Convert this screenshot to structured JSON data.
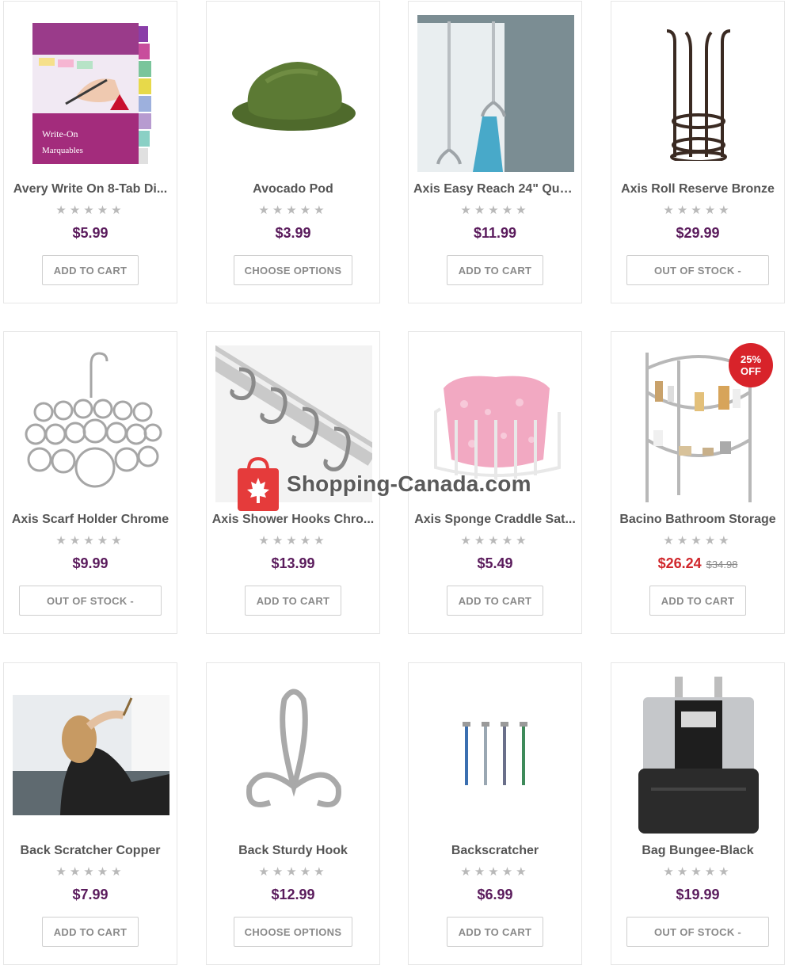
{
  "products": [
    {
      "name": "Avery Write On 8-Tab Di...",
      "stars": "★★★★★",
      "price": "$5.99",
      "button": "ADD TO CART",
      "icon": "binder-dividers-image"
    },
    {
      "name": "Avocado Pod",
      "stars": "★★★★★",
      "price": "$3.99",
      "button": "CHOOSE OPTIONS",
      "icon": "avocado-pod-image"
    },
    {
      "name": "Axis Easy Reach 24\" Qua...",
      "stars": "★★★★★",
      "price": "$11.99",
      "button": "ADD TO CART",
      "icon": "over-door-hook-image"
    },
    {
      "name": "Axis Roll Reserve Bronze",
      "stars": "★★★★★",
      "price": "$29.99",
      "button": "OUT OF STOCK -",
      "icon": "roll-holder-image"
    },
    {
      "name": "Axis Scarf Holder Chrome",
      "stars": "★★★★★",
      "price": "$9.99",
      "button": "OUT OF STOCK -",
      "icon": "scarf-holder-image"
    },
    {
      "name": "Axis Shower Hooks Chro...",
      "stars": "★★★★★",
      "price": "$13.99",
      "button": "ADD TO CART",
      "icon": "shower-hooks-image"
    },
    {
      "name": "Axis Sponge Craddle Sat...",
      "stars": "★★★★★",
      "price": "$5.49",
      "button": "ADD TO CART",
      "icon": "sponge-caddy-image"
    },
    {
      "name": "Bacino Bathroom Storage",
      "stars": "★★★★★",
      "price": "$26.24",
      "old_price": "$34.98",
      "badge_line1": "25%",
      "badge_line2": "OFF",
      "button": "ADD TO CART",
      "icon": "bathroom-shelf-image"
    },
    {
      "name": "Back Scratcher Copper",
      "stars": "★★★★★",
      "price": "$7.99",
      "button": "ADD TO CART",
      "icon": "back-scratcher-photo"
    },
    {
      "name": "Back Sturdy Hook",
      "stars": "★★★★★",
      "price": "$12.99",
      "button": "CHOOSE OPTIONS",
      "icon": "sturdy-hook-image"
    },
    {
      "name": "Backscratcher",
      "stars": "★★★★★",
      "price": "$6.99",
      "button": "ADD TO CART",
      "icon": "backscratchers-image"
    },
    {
      "name": "Bag Bungee-Black",
      "stars": "★★★★★",
      "price": "$19.99",
      "button": "OUT OF STOCK -",
      "icon": "bag-bungee-image"
    }
  ],
  "watermark": {
    "text": "Shopping-Canada.com",
    "icon": "maple-leaf-bag-icon"
  },
  "colors": {
    "price": "#5a1b5c",
    "sale": "#d0262b",
    "badge": "#d8232a",
    "star": "#b9b9b9",
    "button_text": "#8a8a8a"
  }
}
